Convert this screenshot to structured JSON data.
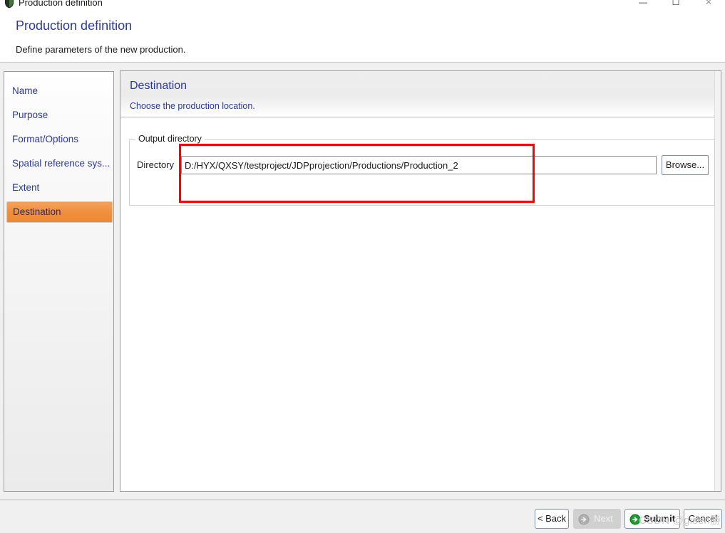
{
  "window": {
    "title": "Production definition",
    "icon": "shield-icon",
    "controls": {
      "minimize": "—",
      "maximize": "☐",
      "close": "✕"
    }
  },
  "header": {
    "title": "Production definition",
    "subtitle": "Define parameters of the new production."
  },
  "sidebar": {
    "items": [
      {
        "label": "Name",
        "selected": false
      },
      {
        "label": "Purpose",
        "selected": false
      },
      {
        "label": "Format/Options",
        "selected": false
      },
      {
        "label": "Spatial reference sys...",
        "selected": false
      },
      {
        "label": "Extent",
        "selected": false
      },
      {
        "label": "Destination",
        "selected": true
      }
    ]
  },
  "panel": {
    "title": "Destination",
    "subtitle": "Choose the production location.",
    "group": {
      "legend": "Output directory",
      "directory_label": "Directory",
      "directory_value": "D:/HYX/QXSY/testproject/JDPprojection/Productions/Production_2",
      "directory_placeholder": "",
      "browse_label": "Browse..."
    }
  },
  "annotation": {
    "highlight_color": "#fb0007"
  },
  "footer": {
    "back_label": "< Back",
    "next_label": "Next",
    "submit_label": "Submit",
    "cancel_label": "Cancel"
  },
  "watermark": {
    "text": "CSDN @gisen勝"
  }
}
